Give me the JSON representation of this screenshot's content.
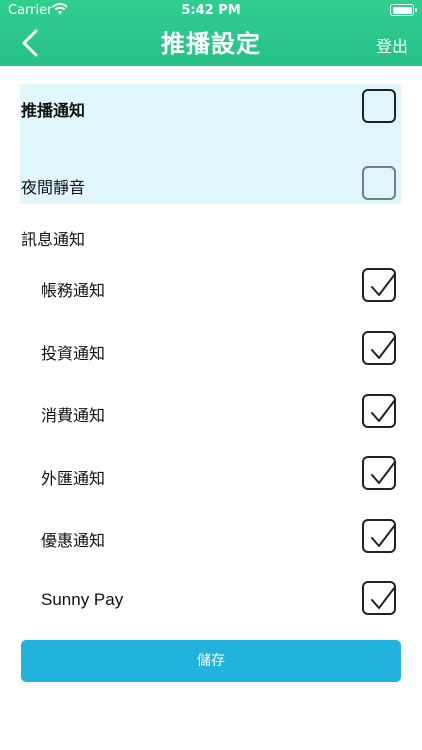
{
  "status": {
    "carrier": "Carrier",
    "time": "5:42 PM"
  },
  "header": {
    "title": "推播設定",
    "logout_label": "登出"
  },
  "settings": {
    "push": {
      "label": "推播通知",
      "checked": false
    },
    "quiet": {
      "label": "夜間靜音",
      "checked": false
    },
    "section_label": "訊息通知",
    "items": [
      {
        "label": "帳務通知",
        "checked": true
      },
      {
        "label": "投資通知",
        "checked": true
      },
      {
        "label": "消費通知",
        "checked": true
      },
      {
        "label": "外匯通知",
        "checked": true
      },
      {
        "label": "優惠通知",
        "checked": true
      },
      {
        "label": "Sunny Pay",
        "checked": true
      }
    ]
  },
  "save_label": "儲存",
  "colors": {
    "header": "#27c08a",
    "highlight": "#e0f6fa",
    "save_button": "#21b3de"
  }
}
